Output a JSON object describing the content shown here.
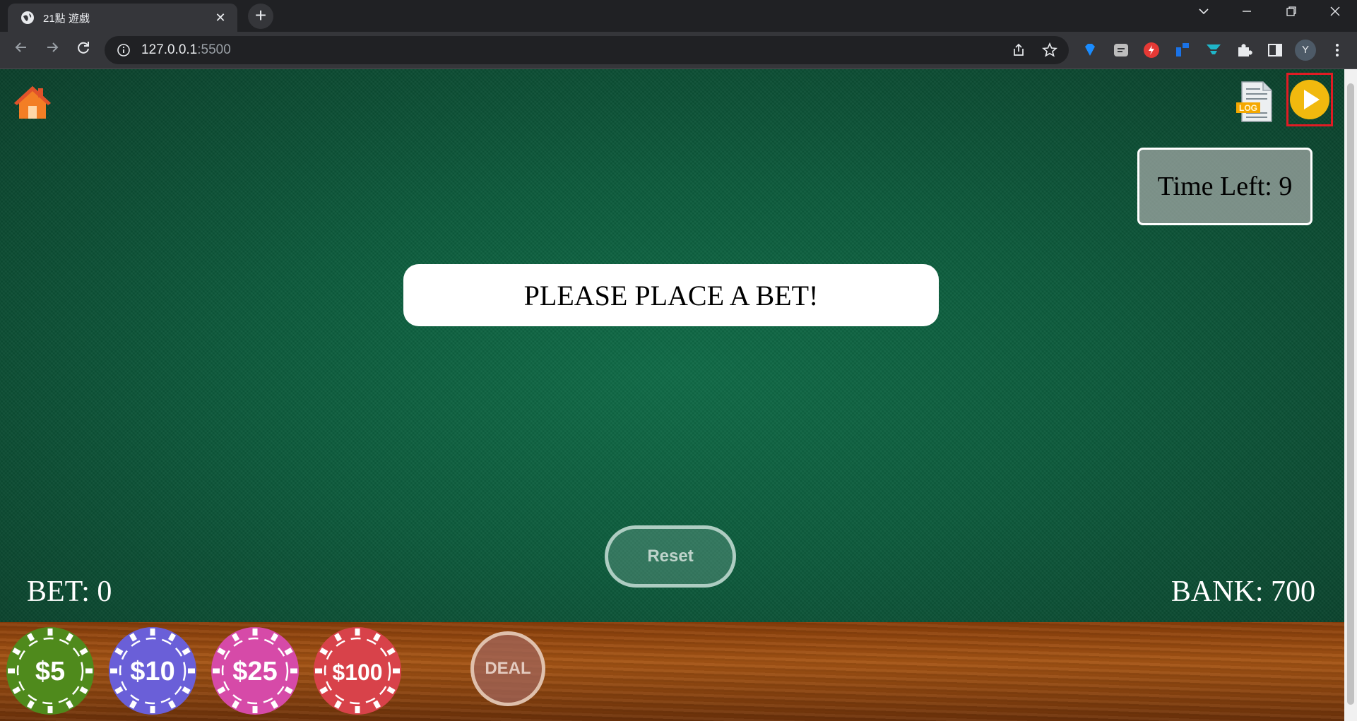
{
  "browser": {
    "tab_title": "21點 遊戲",
    "tab_close": "✕",
    "new_tab": "+",
    "url_host": "127.0.0.1",
    "url_port": ":5500",
    "profile_initial": "Y"
  },
  "game": {
    "message": "PLEASE PLACE A BET!",
    "timer_text": "Time Left: 9",
    "reset_label": "Reset",
    "bet_text": "BET: 0",
    "bank_text": "BANK: 700",
    "deal_label": "DEAL",
    "log_badge": "LOG",
    "chips": [
      {
        "label": "$5",
        "color": "#4f8a1c"
      },
      {
        "label": "$10",
        "color": "#6a5fd8"
      },
      {
        "label": "$25",
        "color": "#d64aa8"
      },
      {
        "label": "$100",
        "color": "#d8424a"
      }
    ]
  },
  "colors": {
    "felt": "#0c5b3c",
    "play_highlight": "#e01c24",
    "play_button": "#f1b90e"
  }
}
